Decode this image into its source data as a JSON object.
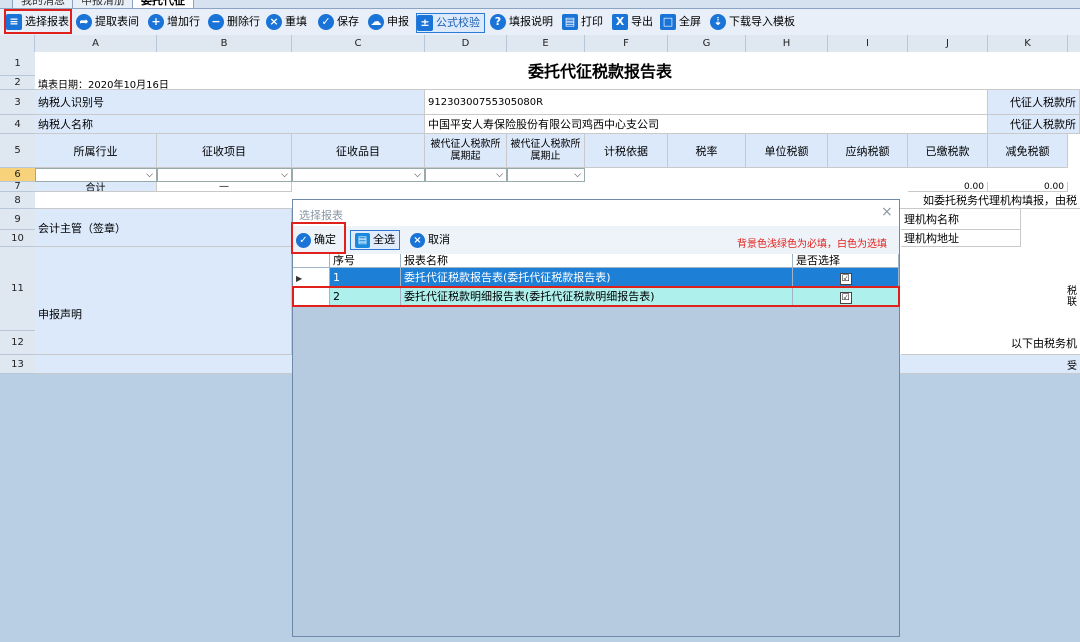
{
  "tabs": [
    "我的消息",
    "申报清册",
    "委托代征"
  ],
  "toolbar": {
    "select_report": "选择报表",
    "fetch_period": "提取表间",
    "add_row": "增加行",
    "delete_row": "删除行",
    "refill": "重填",
    "save": "保存",
    "declare": "申报",
    "formula_check": "公式校验",
    "fill_guide": "填报说明",
    "print": "打印",
    "export": "导出",
    "fullscreen": "全屏",
    "download_template": "下载导入模板"
  },
  "columns": [
    "A",
    "B",
    "C",
    "D",
    "E",
    "F",
    "G",
    "H",
    "I",
    "J",
    "K"
  ],
  "rows": [
    "1",
    "2",
    "3",
    "4",
    "5",
    "6",
    "7",
    "8",
    "9",
    "10",
    "11",
    "12",
    "13"
  ],
  "sheet": {
    "title": "委托代征税款报告表",
    "fill_date": "填表日期：2020年10月16日",
    "taxpayer_id_label": "纳税人识别号",
    "taxpayer_id": "91230300755305080R",
    "agent_tax_label": "代征人税款所",
    "taxpayer_name_label": "纳税人名称",
    "taxpayer_name": "中国平安人寿保险股份有限公司鸡西中心支公司",
    "agent_tax_label2": "代征人税款所",
    "headers": [
      "所属行业",
      "征收项目",
      "征收品目",
      "被代征人税款所属期起",
      "被代征人税款所属期止",
      "计税依据",
      "税率",
      "单位税额",
      "应纳税额",
      "已缴税款",
      "减免税额"
    ],
    "total_label": "合计",
    "total_dash": "—",
    "total_paid": "0.00",
    "total_relief": "0.00",
    "agency_note": "如委托税务代理机构填报，由税",
    "accountant_label": "会计主管（签章）",
    "agency_name": "理机构名称",
    "agency_addr": "理机构地址",
    "declaration_label": "申报声明",
    "tax_contact": "税\n联",
    "tax_office_note": "以下由税务机",
    "accept": "受"
  },
  "dialog": {
    "title": "选择报表",
    "confirm": "确定",
    "select_all": "全选",
    "cancel": "取消",
    "hint": "背景色浅绿色为必填，白色为选填",
    "col_no": "序号",
    "col_name": "报表名称",
    "col_selected": "是否选择",
    "items": [
      {
        "no": "1",
        "name": "委托代征税款报告表(委托代征税款报告表)",
        "checked": "☑"
      },
      {
        "no": "2",
        "name": "委托代征税款明细报告表(委托代征税款明细报告表)",
        "checked": "☑"
      }
    ]
  }
}
